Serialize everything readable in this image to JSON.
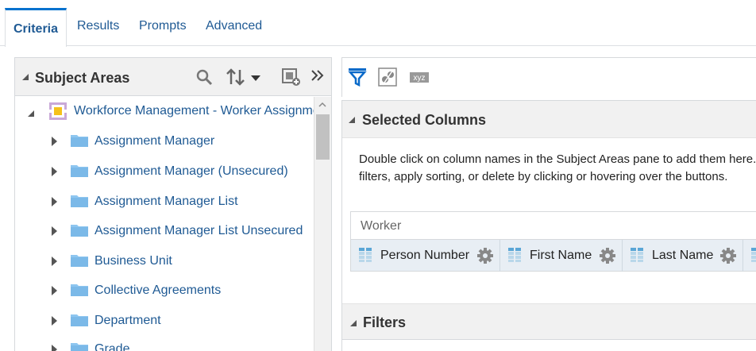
{
  "tabs": [
    {
      "label": "Criteria",
      "active": true
    },
    {
      "label": "Results",
      "active": false
    },
    {
      "label": "Prompts",
      "active": false
    },
    {
      "label": "Advanced",
      "active": false
    }
  ],
  "subject_areas": {
    "title": "Subject Areas",
    "tree": {
      "root": "Workforce Management - Worker Assignment",
      "items": [
        "Assignment Manager",
        "Assignment Manager (Unsecured)",
        "Assignment Manager List",
        "Assignment Manager List Unsecured",
        "Business Unit",
        "Collective Agreements",
        "Department",
        "Grade"
      ]
    }
  },
  "selected_columns": {
    "title": "Selected Columns",
    "description_line1": "Double click on column names in the Subject Areas pane to add them here. You can add",
    "description_line2": "filters, apply sorting, or delete by clicking or hovering over the buttons.",
    "group_label": "Worker",
    "columns": [
      "Person Number",
      "First Name",
      "Last Name"
    ]
  },
  "filters": {
    "title": "Filters"
  },
  "toolbar": {
    "xyz_label": "xyz"
  },
  "colors": {
    "accent": "#0572ce",
    "link": "#1f5a94",
    "folder": "#8ec6f0",
    "header_bg": "#f1f1f1"
  }
}
